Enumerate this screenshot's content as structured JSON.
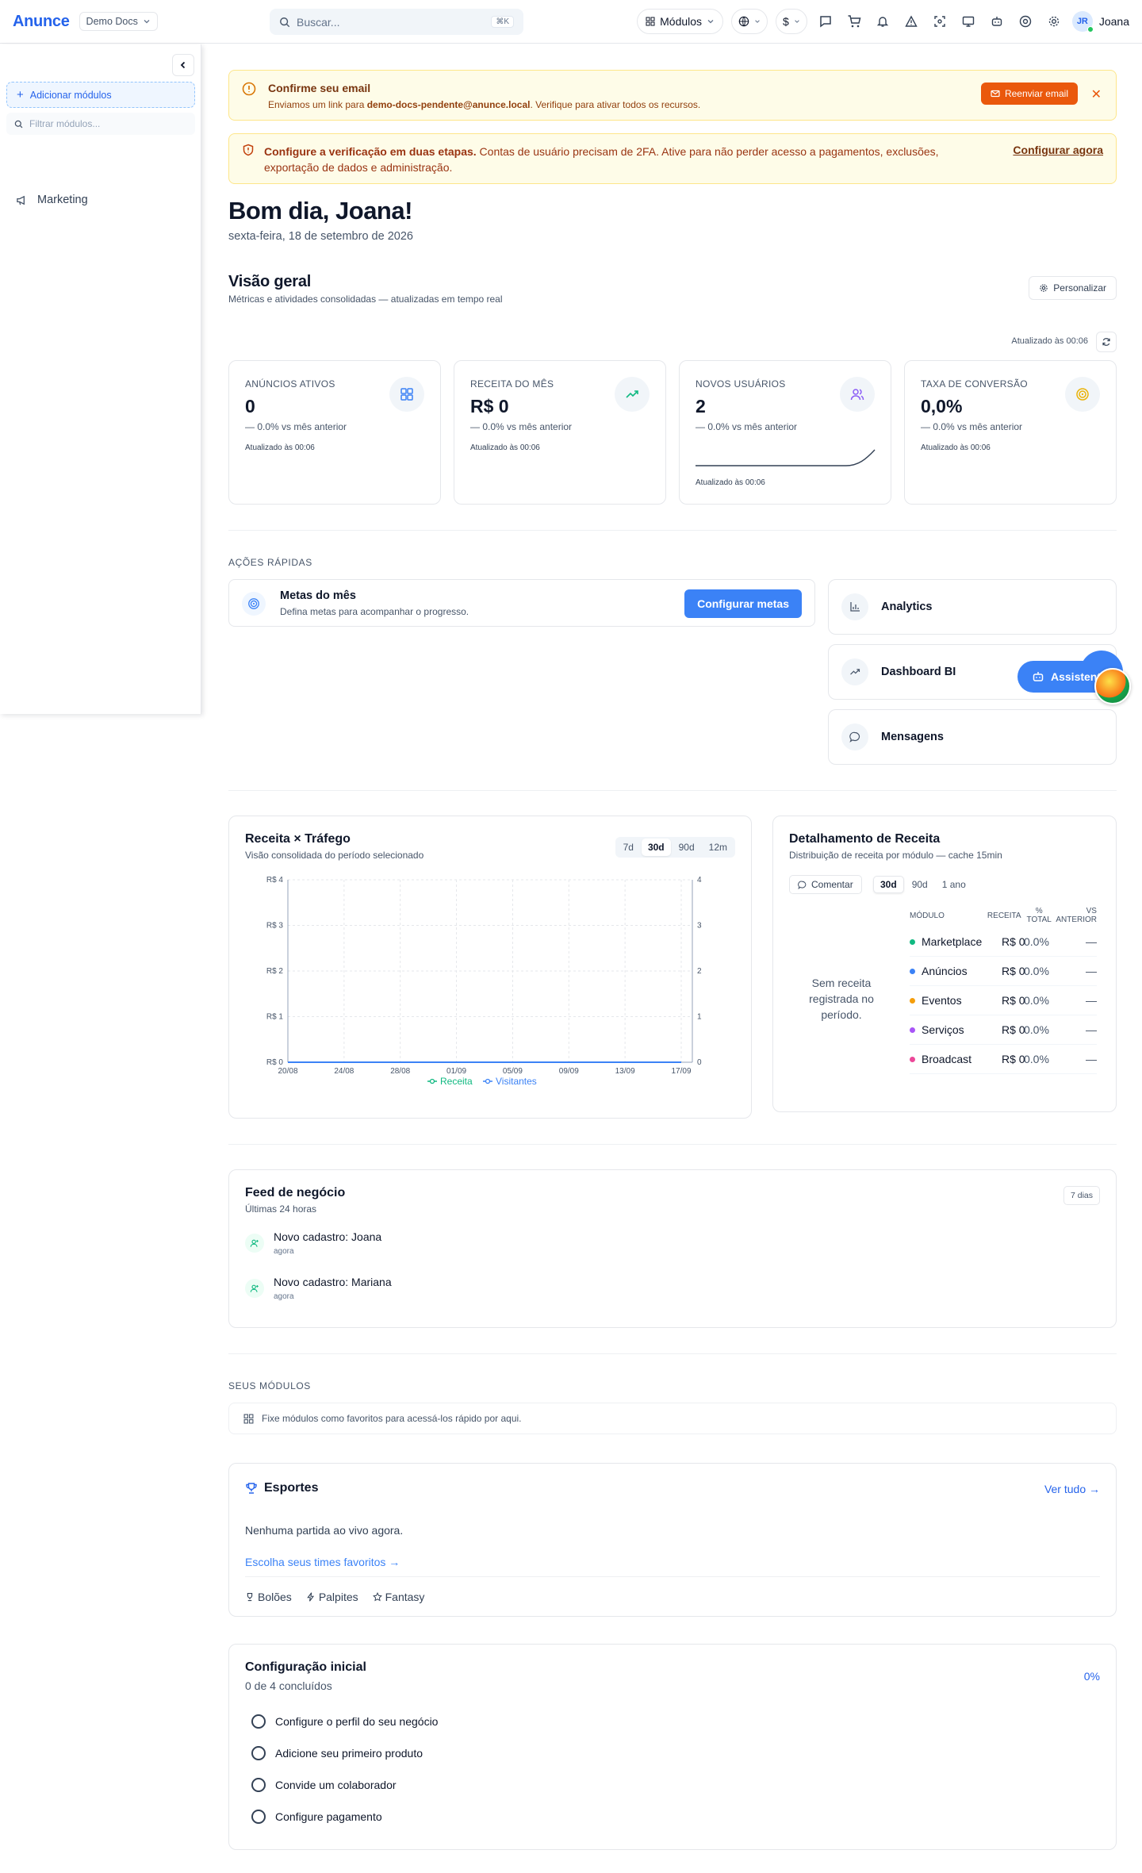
{
  "header": {
    "logo": "Anunce",
    "workspace": "Demo Docs",
    "search_placeholder": "Buscar...",
    "search_shortcut": "⌘K",
    "modules_label": "Módulos",
    "currency_symbol": "$",
    "user_initials": "JR",
    "user_name": "Joana"
  },
  "sidebar": {
    "add_modules": "Adicionar módulos",
    "filter_placeholder": "Filtrar módulos...",
    "items": [
      {
        "label": "Marketing"
      }
    ]
  },
  "alerts": {
    "email": {
      "title": "Confirme seu email",
      "text_prefix": "Enviamos um link para ",
      "email": "demo-docs-pendente@anunce.local",
      "text_suffix": ". Verifique para ativar todos os recursos.",
      "button": "Reenviar email"
    },
    "twofa": {
      "title": "Configure a verificação em duas etapas.",
      "text": " Contas de usuário precisam de 2FA. Ative para não perder acesso a pagamentos, exclusões, exportação de dados e administração.",
      "link": "Configurar agora"
    }
  },
  "greeting": {
    "title": "Bom dia, Joana!",
    "date": "sexta-feira, 18 de setembro de 2026"
  },
  "overview": {
    "title": "Visão geral",
    "subtitle": "Métricas e atividades consolidadas — atualizadas em tempo real",
    "customize": "Personalizar",
    "updated": "Atualizado às 00:06"
  },
  "kpis": [
    {
      "label": "ANÚNCIOS ATIVOS",
      "value": "0",
      "delta": "— 0.0%  vs mês anterior",
      "updated": "Atualizado às 00:06",
      "icon": "grid-icon",
      "color": "#3b82f6"
    },
    {
      "label": "RECEITA DO MÊS",
      "value": "R$ 0",
      "delta": "— 0.0%  vs mês anterior",
      "updated": "Atualizado às 00:06",
      "icon": "trending-up-icon",
      "color": "#10b981"
    },
    {
      "label": "NOVOS USUÁRIOS",
      "value": "2",
      "delta": "— 0.0%  vs mês anterior",
      "updated": "Atualizado às 00:06",
      "icon": "users-icon",
      "color": "#8b5cf6"
    },
    {
      "label": "TAXA DE CONVERSÃO",
      "value": "0,0%",
      "delta": "— 0.0%  vs mês anterior",
      "updated": "Atualizado às 00:06",
      "icon": "target-icon",
      "color": "#eab308"
    }
  ],
  "quick_actions": {
    "label": "AÇÕES RÁPIDAS",
    "goal_title": "Metas do mês",
    "goal_subtitle": "Defina metas para acompanhar o progresso.",
    "goal_button": "Configurar metas",
    "cards": [
      {
        "label": "Analytics",
        "icon": "bar-chart-icon"
      },
      {
        "label": "Dashboard BI",
        "icon": "trending-up-icon"
      },
      {
        "label": "Mensagens",
        "icon": "message-icon"
      }
    ],
    "assistant": "Assistente"
  },
  "revenue_traffic": {
    "title": "Receita × Tráfego",
    "subtitle": "Visão consolidada do período selecionado",
    "ranges": [
      "7d",
      "30d",
      "90d",
      "12m"
    ],
    "selected_range": "30d"
  },
  "chart_data": {
    "type": "line",
    "title": "Receita × Tráfego",
    "x": [
      "20/08",
      "24/08",
      "28/08",
      "01/09",
      "05/09",
      "09/09",
      "13/09",
      "17/09"
    ],
    "y_left_ticks": [
      "R$ 4",
      "R$ 3",
      "R$ 2",
      "R$ 1",
      "R$ 0"
    ],
    "y_right_ticks": [
      "4",
      "3",
      "2",
      "1",
      "0"
    ],
    "ylim": [
      0,
      4
    ],
    "grid": true,
    "legend_position": "bottom",
    "series": [
      {
        "name": "Receita",
        "color": "#10b981",
        "values": [
          0,
          0,
          0,
          0,
          0,
          0,
          0,
          0
        ]
      },
      {
        "name": "Visitantes",
        "color": "#3b82f6",
        "values": [
          0,
          0,
          0,
          0,
          0,
          0,
          0,
          0
        ]
      }
    ]
  },
  "revenue_breakdown": {
    "title": "Detalhamento de Receita",
    "subtitle": "Distribuição de receita por módulo — cache 15min",
    "comment": "Comentar",
    "ranges": [
      "30d",
      "90d",
      "1 ano"
    ],
    "selected_range": "30d",
    "empty": "Sem receita registrada no período.",
    "columns": [
      "MÓDULO",
      "RECEITA",
      "% TOTAL",
      "VS ANTERIOR"
    ],
    "rows": [
      {
        "name": "Marketplace",
        "value": "R$ 0",
        "pct": "0.0%",
        "vs": "—",
        "color": "#10b981"
      },
      {
        "name": "Anúncios",
        "value": "R$ 0",
        "pct": "0.0%",
        "vs": "—",
        "color": "#3b82f6"
      },
      {
        "name": "Eventos",
        "value": "R$ 0",
        "pct": "0.0%",
        "vs": "—",
        "color": "#f59e0b"
      },
      {
        "name": "Serviços",
        "value": "R$ 0",
        "pct": "0.0%",
        "vs": "—",
        "color": "#a855f7"
      },
      {
        "name": "Broadcast",
        "value": "R$ 0",
        "pct": "0.0%",
        "vs": "—",
        "color": "#ec4899"
      }
    ]
  },
  "feed": {
    "title": "Feed de negócio",
    "subtitle": "Últimas 24 horas",
    "range": "7 dias",
    "items": [
      {
        "title": "Novo cadastro: Joana",
        "time": "agora"
      },
      {
        "title": "Novo cadastro: Mariana",
        "time": "agora"
      }
    ]
  },
  "modules": {
    "label": "SEUS MÓDULOS",
    "hint": "Fixe módulos como favoritos para acessá-los rápido por aqui."
  },
  "sports": {
    "title": "Esportes",
    "see_all": "Ver tudo →",
    "empty": "Nenhuma partida ao vivo agora.",
    "choose": "Escolha seus times favoritos →",
    "links": [
      "Bolões",
      "Palpites",
      "Fantasy"
    ]
  },
  "setup": {
    "title": "Configuração inicial",
    "subtitle": "0 de 4 concluídos",
    "progress": "0%",
    "items": [
      "Configure o perfil do seu negócio",
      "Adicione seu primeiro produto",
      "Convide um colaborador",
      "Configure pagamento"
    ]
  }
}
